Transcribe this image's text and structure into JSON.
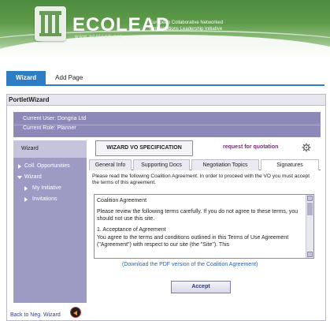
{
  "header": {
    "brand": "ECOLEAD",
    "brand_sub": "www.ecolead.org",
    "tagline": "European Collaborative Networked Organizations Leadership Initiative"
  },
  "tabs": [
    {
      "label": "Wizard",
      "active": true
    },
    {
      "label": "Add Page",
      "active": false
    }
  ],
  "portlet": {
    "title": "PortletWizard",
    "current_user": "Current User: Dongria Ltd",
    "current_role": "Current Role: Planner"
  },
  "leftnav": {
    "header": "Wizard",
    "items": [
      {
        "label": "Coll. Opportunities",
        "icon": "triangle-right-icon"
      },
      {
        "label": "Wizard",
        "icon": "triangle-down-icon"
      },
      {
        "label": "My Initiative",
        "icon": "triangle-right-icon"
      },
      {
        "label": "Invitations",
        "icon": "triangle-right-icon"
      }
    ],
    "back_link": "Back to Neg. Wizard"
  },
  "main": {
    "title": "WIZARD VO SPECIFICATION",
    "request_link": "request for quotation",
    "subtabs": [
      {
        "label": "General Info",
        "active": false
      },
      {
        "label": "Supporting Docs",
        "active": false
      },
      {
        "label": "Negotiation Topics",
        "active": false
      },
      {
        "label": "Signatures",
        "active": true
      }
    ],
    "intro": "Please read the following Coalition Agreement. In order to proceed with the VO you must accept the terms of this agreement.",
    "agreement": {
      "heading": "Coalition Agreement",
      "para1": "Please review the following terms carefully. If you do not agree to these terms, you should not use this site.",
      "section": "1. Acceptance of Agreement",
      "para2": "You agree to the terms and conditions outlined in this Terms of Use Agreement (\"Agreement\") with respect to our site (the \"Site\"). This"
    },
    "pdf_link": "(Download the PDF version of the Coalition Agreement)",
    "accept_label": "Accept"
  },
  "colors": {
    "tab_active": "#2e7cc4",
    "purple_bar": "#8c88b8",
    "nav_bg": "#9d9ac4"
  }
}
